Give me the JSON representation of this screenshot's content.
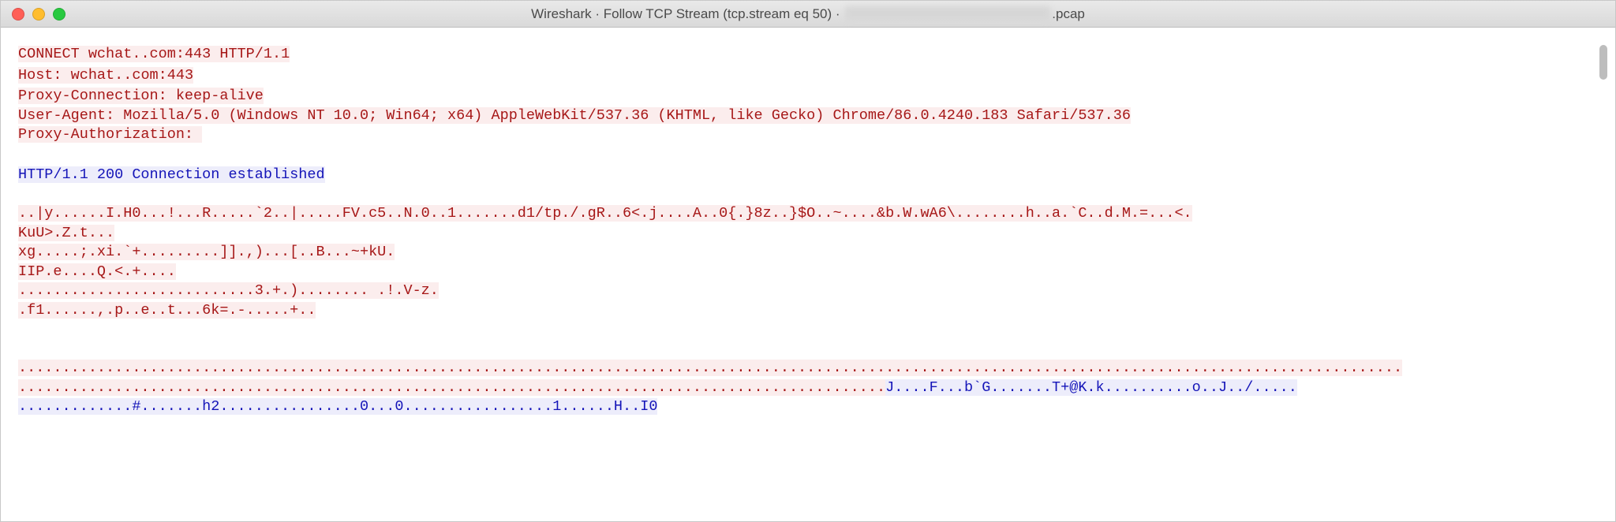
{
  "titlebar": {
    "app": "Wireshark",
    "sep1": " · ",
    "follow": "Follow TCP Stream (tcp.stream eq 50)",
    "sep2": " · ",
    "file_suffix": ".pcap"
  },
  "stream": {
    "client": {
      "connect_pre": "CONNECT wchat.",
      "connect_post": ".com:443 HTTP/1.1",
      "host_pre": "Host: wchat.",
      "host_post": ".com:443",
      "proxy_conn": "Proxy-Connection: keep-alive",
      "user_agent": "User-Agent: Mozilla/5.0 (Windows NT 10.0; Win64; x64) AppleWebKit/537.36 (KHTML, like Gecko) Chrome/86.0.4240.183 Safari/537.36",
      "proxy_auth_pre": "Proxy-Authorization: "
    },
    "server": {
      "status": "HTTP/1.1 200 Connection established"
    },
    "binary_client": {
      "line1": "..|y......I.H0...!...R.....`2..|.....FV.c5..N.0..1.......d1/tp./.gR..6<.j....A..0{.}8z..}$O..~....&b.W.wA6\\........h..a.`C..d.M.=...<.",
      "line2": "KuU>.Z.t...",
      "line3": "xg.....;.xi.`+.........]].,)...[..B...~+kU.",
      "line4": "IIP.e....Q.<.+....",
      "line5": "...........................3.+.)........ .!.V-z.",
      "line6": ".f1......,.p..e..t...6k=.-.....+..",
      "dots1": "..............................................................................................................................................................",
      "dots2a": "..................................................................................................."
    },
    "binary_server": {
      "part2b": "J....F...b`G.......T+@K.k..........o..J../.....",
      "line3": ".............#.......h2................0...0.................1......H..I0"
    }
  }
}
